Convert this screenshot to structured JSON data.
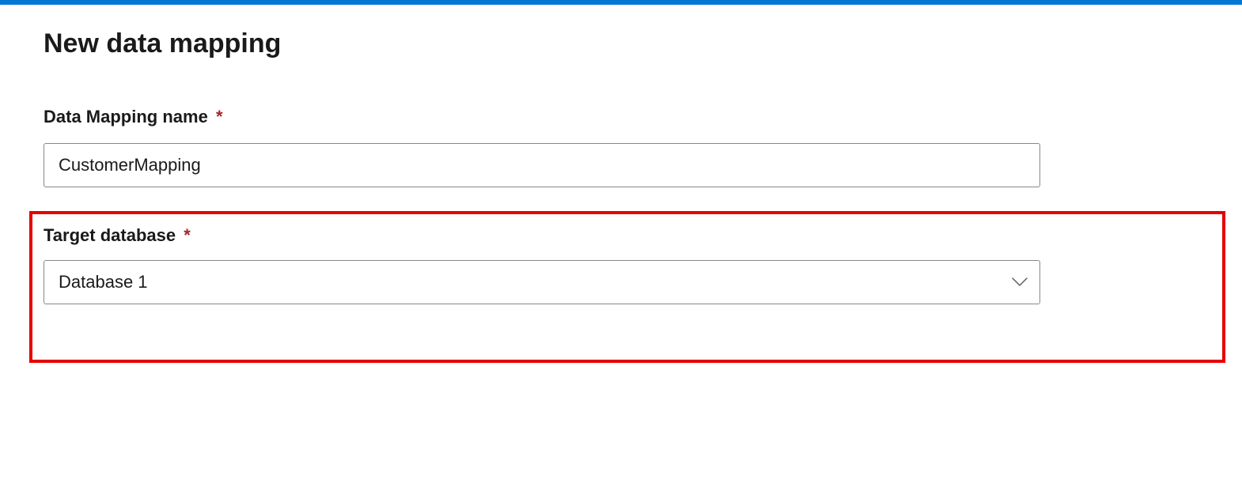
{
  "header": {
    "title": "New data mapping"
  },
  "fields": {
    "mappingName": {
      "label": "Data Mapping name",
      "required": "*",
      "value": "CustomerMapping"
    },
    "targetDatabase": {
      "label": "Target database",
      "required": "*",
      "selected": "Database 1"
    }
  }
}
